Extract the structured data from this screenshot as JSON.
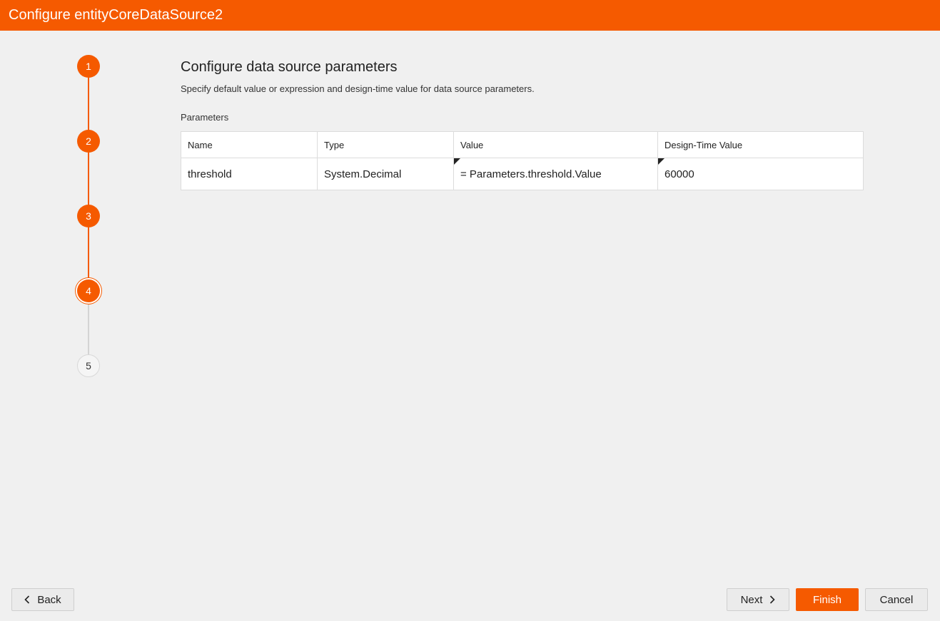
{
  "window": {
    "title": "Configure entityCoreDataSource2"
  },
  "stepper": {
    "steps": [
      {
        "label": "1",
        "state": "done"
      },
      {
        "label": "2",
        "state": "done"
      },
      {
        "label": "3",
        "state": "done"
      },
      {
        "label": "4",
        "state": "current"
      },
      {
        "label": "5",
        "state": "todo"
      }
    ],
    "accent_color": "#f55a00"
  },
  "main": {
    "title": "Configure data source parameters",
    "description": "Specify default value or expression and design-time value for data source parameters.",
    "parameters_label": "Parameters",
    "table": {
      "columns": [
        "Name",
        "Type",
        "Value",
        "Design-Time Value"
      ],
      "rows": [
        {
          "name": "threshold",
          "type": "System.Decimal",
          "value": "= Parameters.threshold.Value",
          "design_time_value": "60000"
        }
      ]
    }
  },
  "footer": {
    "back_label": "Back",
    "next_label": "Next",
    "finish_label": "Finish",
    "cancel_label": "Cancel",
    "back_icon": "chevron-left-icon",
    "next_icon": "chevron-right-icon"
  }
}
